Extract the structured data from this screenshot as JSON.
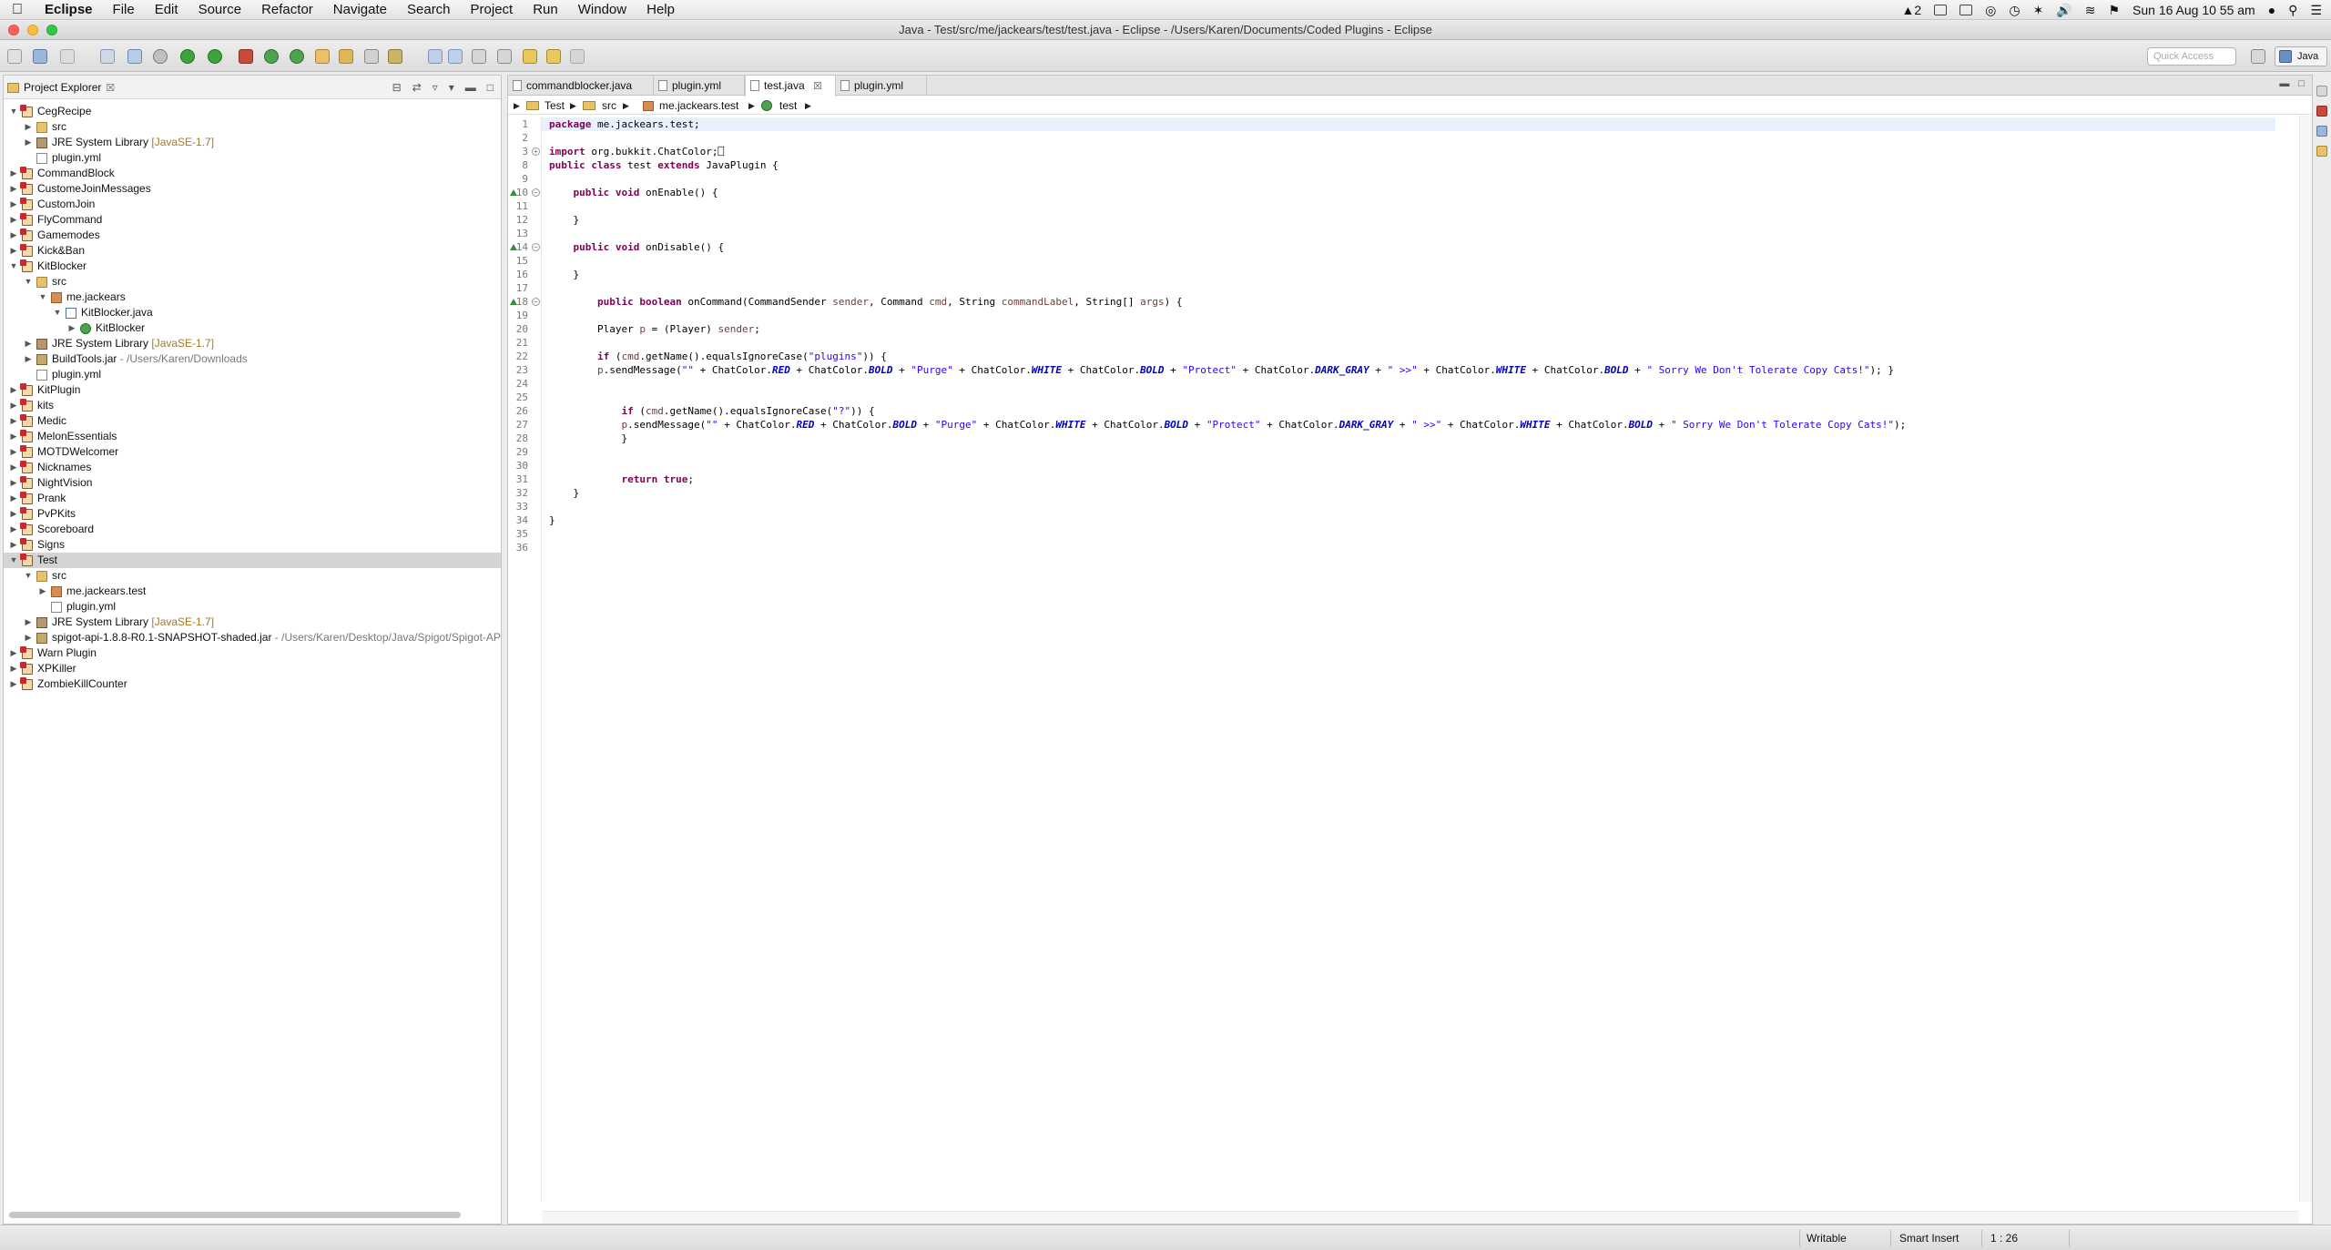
{
  "menubar": {
    "app": "Eclipse",
    "items": [
      "File",
      "Edit",
      "Source",
      "Refactor",
      "Navigate",
      "Search",
      "Project",
      "Run",
      "Window",
      "Help"
    ],
    "status_num": "2",
    "clock": "Sun 16 Aug  10 55 am"
  },
  "window": {
    "title": "Java - Test/src/me/jackears/test/test.java - Eclipse - /Users/Karen/Documents/Coded Plugins - Eclipse"
  },
  "toolbar": {
    "quick_access_placeholder": "Quick Access",
    "perspective": "Java"
  },
  "explorer": {
    "title": "Project Explorer",
    "tree": [
      {
        "label": "CegRecipe",
        "icon": "project-icon",
        "level": 0,
        "tw": "open"
      },
      {
        "label": "src",
        "icon": "folder-icon",
        "level": 1,
        "tw": "closed"
      },
      {
        "label": "JRE System Library",
        "deco": "[JavaSE-1.7]",
        "icon": "library-icon",
        "level": 1,
        "tw": "closed"
      },
      {
        "label": "plugin.yml",
        "icon": "file-icon",
        "level": 1,
        "tw": ""
      },
      {
        "label": "CommandBlock",
        "icon": "project-icon",
        "level": 0,
        "tw": "closed"
      },
      {
        "label": "CustomeJoinMessages",
        "icon": "project-icon",
        "level": 0,
        "tw": "closed"
      },
      {
        "label": "CustomJoin",
        "icon": "project-icon",
        "level": 0,
        "tw": "closed"
      },
      {
        "label": "FlyCommand",
        "icon": "project-icon",
        "level": 0,
        "tw": "closed"
      },
      {
        "label": "Gamemodes",
        "icon": "project-icon",
        "level": 0,
        "tw": "closed"
      },
      {
        "label": "Kick&Ban",
        "icon": "project-icon",
        "level": 0,
        "tw": "closed"
      },
      {
        "label": "KitBlocker",
        "icon": "project-icon",
        "level": 0,
        "tw": "open"
      },
      {
        "label": "src",
        "icon": "folder-icon",
        "level": 1,
        "tw": "open"
      },
      {
        "label": "me.jackears",
        "icon": "package-icon",
        "level": 2,
        "tw": "open"
      },
      {
        "label": "KitBlocker.java",
        "icon": "java-file-icon",
        "level": 3,
        "tw": "open"
      },
      {
        "label": "KitBlocker",
        "icon": "class-icon",
        "level": 4,
        "tw": "closed"
      },
      {
        "label": "JRE System Library",
        "deco": "[JavaSE-1.7]",
        "icon": "library-icon",
        "level": 1,
        "tw": "closed"
      },
      {
        "label": "BuildTools.jar",
        "path": " - /Users/Karen/Downloads",
        "icon": "jar-icon",
        "level": 1,
        "tw": "closed"
      },
      {
        "label": "plugin.yml",
        "icon": "file-icon",
        "level": 1,
        "tw": ""
      },
      {
        "label": "KitPlugin",
        "icon": "project-icon",
        "level": 0,
        "tw": "closed"
      },
      {
        "label": "kits",
        "icon": "project-icon",
        "level": 0,
        "tw": "closed"
      },
      {
        "label": "Medic",
        "icon": "project-icon",
        "level": 0,
        "tw": "closed"
      },
      {
        "label": "MelonEssentials",
        "icon": "project-icon",
        "level": 0,
        "tw": "closed"
      },
      {
        "label": "MOTDWelcomer",
        "icon": "project-icon",
        "level": 0,
        "tw": "closed"
      },
      {
        "label": "Nicknames",
        "icon": "project-icon",
        "level": 0,
        "tw": "closed"
      },
      {
        "label": "NightVision",
        "icon": "project-icon",
        "level": 0,
        "tw": "closed"
      },
      {
        "label": "Prank",
        "icon": "project-icon",
        "level": 0,
        "tw": "closed"
      },
      {
        "label": "PvPKits",
        "icon": "project-icon",
        "level": 0,
        "tw": "closed"
      },
      {
        "label": "Scoreboard",
        "icon": "project-icon",
        "level": 0,
        "tw": "closed"
      },
      {
        "label": "Signs",
        "icon": "project-icon",
        "level": 0,
        "tw": "closed"
      },
      {
        "label": "Test",
        "icon": "project-icon",
        "level": 0,
        "tw": "open",
        "selected": true
      },
      {
        "label": "src",
        "icon": "folder-icon",
        "level": 1,
        "tw": "open"
      },
      {
        "label": "me.jackears.test",
        "icon": "package-icon",
        "level": 2,
        "tw": "closed"
      },
      {
        "label": "plugin.yml",
        "icon": "file-icon",
        "level": 2,
        "tw": ""
      },
      {
        "label": "JRE System Library",
        "deco": "[JavaSE-1.7]",
        "icon": "library-icon",
        "level": 1,
        "tw": "closed"
      },
      {
        "label": "spigot-api-1.8.8-R0.1-SNAPSHOT-shaded.jar",
        "path": " - /Users/Karen/Desktop/Java/Spigot/Spigot-AP",
        "icon": "jar-icon",
        "level": 1,
        "tw": "closed"
      },
      {
        "label": "Warn Plugin",
        "icon": "project-icon",
        "level": 0,
        "tw": "closed"
      },
      {
        "label": "XPKiller",
        "icon": "project-icon",
        "level": 0,
        "tw": "closed"
      },
      {
        "label": "ZombieKillCounter",
        "icon": "project-icon",
        "level": 0,
        "tw": "closed"
      }
    ]
  },
  "editor": {
    "tabs": [
      "commandblocker.java",
      "plugin.yml",
      "test.java",
      "plugin.yml"
    ],
    "active_tab": 2,
    "breadcrumb": [
      "Test",
      "src",
      "me.jackears.test",
      "test"
    ],
    "lines": [
      [
        [
          "kw",
          "package"
        ],
        [
          "t",
          " me.jackears.test;"
        ]
      ],
      [],
      [
        [
          "kw",
          "import"
        ],
        [
          "t",
          " org.bukkit.ChatColor;"
        ],
        [
          "t",
          "⎕"
        ]
      ],
      [
        [
          "kw",
          "public"
        ],
        [
          "t",
          " "
        ],
        [
          "kw",
          "class"
        ],
        [
          "t",
          " test "
        ],
        [
          "kw",
          "extends"
        ],
        [
          "t",
          " JavaPlugin {"
        ]
      ],
      [],
      [
        [
          "t",
          "    "
        ],
        [
          "kw",
          "public"
        ],
        [
          "t",
          " "
        ],
        [
          "kw",
          "void"
        ],
        [
          "t",
          " onEnable() {"
        ]
      ],
      [],
      [
        [
          "t",
          "    }"
        ]
      ],
      [],
      [
        [
          "t",
          "    "
        ],
        [
          "kw",
          "public"
        ],
        [
          "t",
          " "
        ],
        [
          "kw",
          "void"
        ],
        [
          "t",
          " onDisable() {"
        ]
      ],
      [],
      [
        [
          "t",
          "    }"
        ]
      ],
      [],
      [
        [
          "t",
          "        "
        ],
        [
          "kw",
          "public"
        ],
        [
          "t",
          " "
        ],
        [
          "kw",
          "boolean"
        ],
        [
          "t",
          " onCommand(CommandSender "
        ],
        [
          "var",
          "sender"
        ],
        [
          "t",
          ", Command "
        ],
        [
          "var",
          "cmd"
        ],
        [
          "t",
          ", String "
        ],
        [
          "var",
          "commandLabel"
        ],
        [
          "t",
          ", String[] "
        ],
        [
          "var",
          "args"
        ],
        [
          "t",
          ") {"
        ]
      ],
      [],
      [
        [
          "t",
          "        Player "
        ],
        [
          "var",
          "p"
        ],
        [
          "t",
          " = (Player) "
        ],
        [
          "var",
          "sender"
        ],
        [
          "t",
          ";"
        ]
      ],
      [],
      [
        [
          "t",
          "        "
        ],
        [
          "kw",
          "if"
        ],
        [
          "t",
          " ("
        ],
        [
          "var",
          "cmd"
        ],
        [
          "t",
          ".getName().equalsIgnoreCase("
        ],
        [
          "str",
          "\"plugins\""
        ],
        [
          "t",
          ")) {"
        ]
      ],
      [
        [
          "t",
          "        "
        ],
        [
          "var",
          "p"
        ],
        [
          "t",
          ".sendMessage("
        ],
        [
          "str",
          "\"\""
        ],
        [
          "t",
          " + ChatColor."
        ],
        [
          "fld",
          "RED"
        ],
        [
          "t",
          " + ChatColor."
        ],
        [
          "fld",
          "BOLD"
        ],
        [
          "t",
          " + "
        ],
        [
          "str",
          "\"Purge\""
        ],
        [
          "t",
          " + ChatColor."
        ],
        [
          "fld",
          "WHITE"
        ],
        [
          "t",
          " + ChatColor."
        ],
        [
          "fld",
          "BOLD"
        ],
        [
          "t",
          " + "
        ],
        [
          "str",
          "\"Protect\""
        ],
        [
          "t",
          " + ChatColor."
        ],
        [
          "fld",
          "DARK_GRAY"
        ],
        [
          "t",
          " + "
        ],
        [
          "str",
          "\" >>\""
        ],
        [
          "t",
          " + ChatColor."
        ],
        [
          "fld",
          "WHITE"
        ],
        [
          "t",
          " + ChatColor."
        ],
        [
          "fld",
          "BOLD"
        ],
        [
          "t",
          " + "
        ],
        [
          "str",
          "\" Sorry We Don't Tolerate Copy Cats!\""
        ],
        [
          "t",
          "); }"
        ]
      ],
      [],
      [],
      [
        [
          "t",
          "            "
        ],
        [
          "kw",
          "if"
        ],
        [
          "t",
          " ("
        ],
        [
          "var",
          "cmd"
        ],
        [
          "t",
          ".getName().equalsIgnoreCase("
        ],
        [
          "str",
          "\"?\""
        ],
        [
          "t",
          ")) {"
        ]
      ],
      [
        [
          "t",
          "            "
        ],
        [
          "var",
          "p"
        ],
        [
          "t",
          ".sendMessage("
        ],
        [
          "str",
          "\"\""
        ],
        [
          "t",
          " + ChatColor."
        ],
        [
          "fld",
          "RED"
        ],
        [
          "t",
          " + ChatColor."
        ],
        [
          "fld",
          "BOLD"
        ],
        [
          "t",
          " + "
        ],
        [
          "str",
          "\"Purge\""
        ],
        [
          "t",
          " + ChatColor."
        ],
        [
          "fld",
          "WHITE"
        ],
        [
          "t",
          " + ChatColor."
        ],
        [
          "fld",
          "BOLD"
        ],
        [
          "t",
          " + "
        ],
        [
          "str",
          "\"Protect\""
        ],
        [
          "t",
          " + ChatColor."
        ],
        [
          "fld",
          "DARK_GRAY"
        ],
        [
          "t",
          " + "
        ],
        [
          "str",
          "\" >>\""
        ],
        [
          "t",
          " + ChatColor."
        ],
        [
          "fld",
          "WHITE"
        ],
        [
          "t",
          " + ChatColor."
        ],
        [
          "fld",
          "BOLD"
        ],
        [
          "t",
          " + "
        ],
        [
          "str",
          "\" Sorry We Don't Tolerate Copy Cats!\""
        ],
        [
          "t",
          ");"
        ]
      ],
      [
        [
          "t",
          "            }"
        ]
      ],
      [],
      [],
      [
        [
          "t",
          "            "
        ],
        [
          "kw",
          "return"
        ],
        [
          "t",
          " "
        ],
        [
          "kw",
          "true"
        ],
        [
          "t",
          ";"
        ]
      ],
      [
        [
          "t",
          "    }"
        ]
      ],
      [],
      [
        [
          "t",
          "}"
        ]
      ],
      []
    ],
    "line_numbers": [
      "1",
      "2",
      "3",
      "8",
      "9",
      "10",
      "11",
      "12",
      "13",
      "14",
      "15",
      "16",
      "17",
      "18",
      "19",
      "20",
      "21",
      "22",
      "23",
      "24",
      "25",
      "26",
      "27",
      "28",
      "29",
      "30",
      "31",
      "32",
      "33",
      "34",
      "35",
      "36"
    ]
  },
  "status": {
    "writable": "Writable",
    "insert_mode": "Smart Insert",
    "position": "1 : 26"
  }
}
